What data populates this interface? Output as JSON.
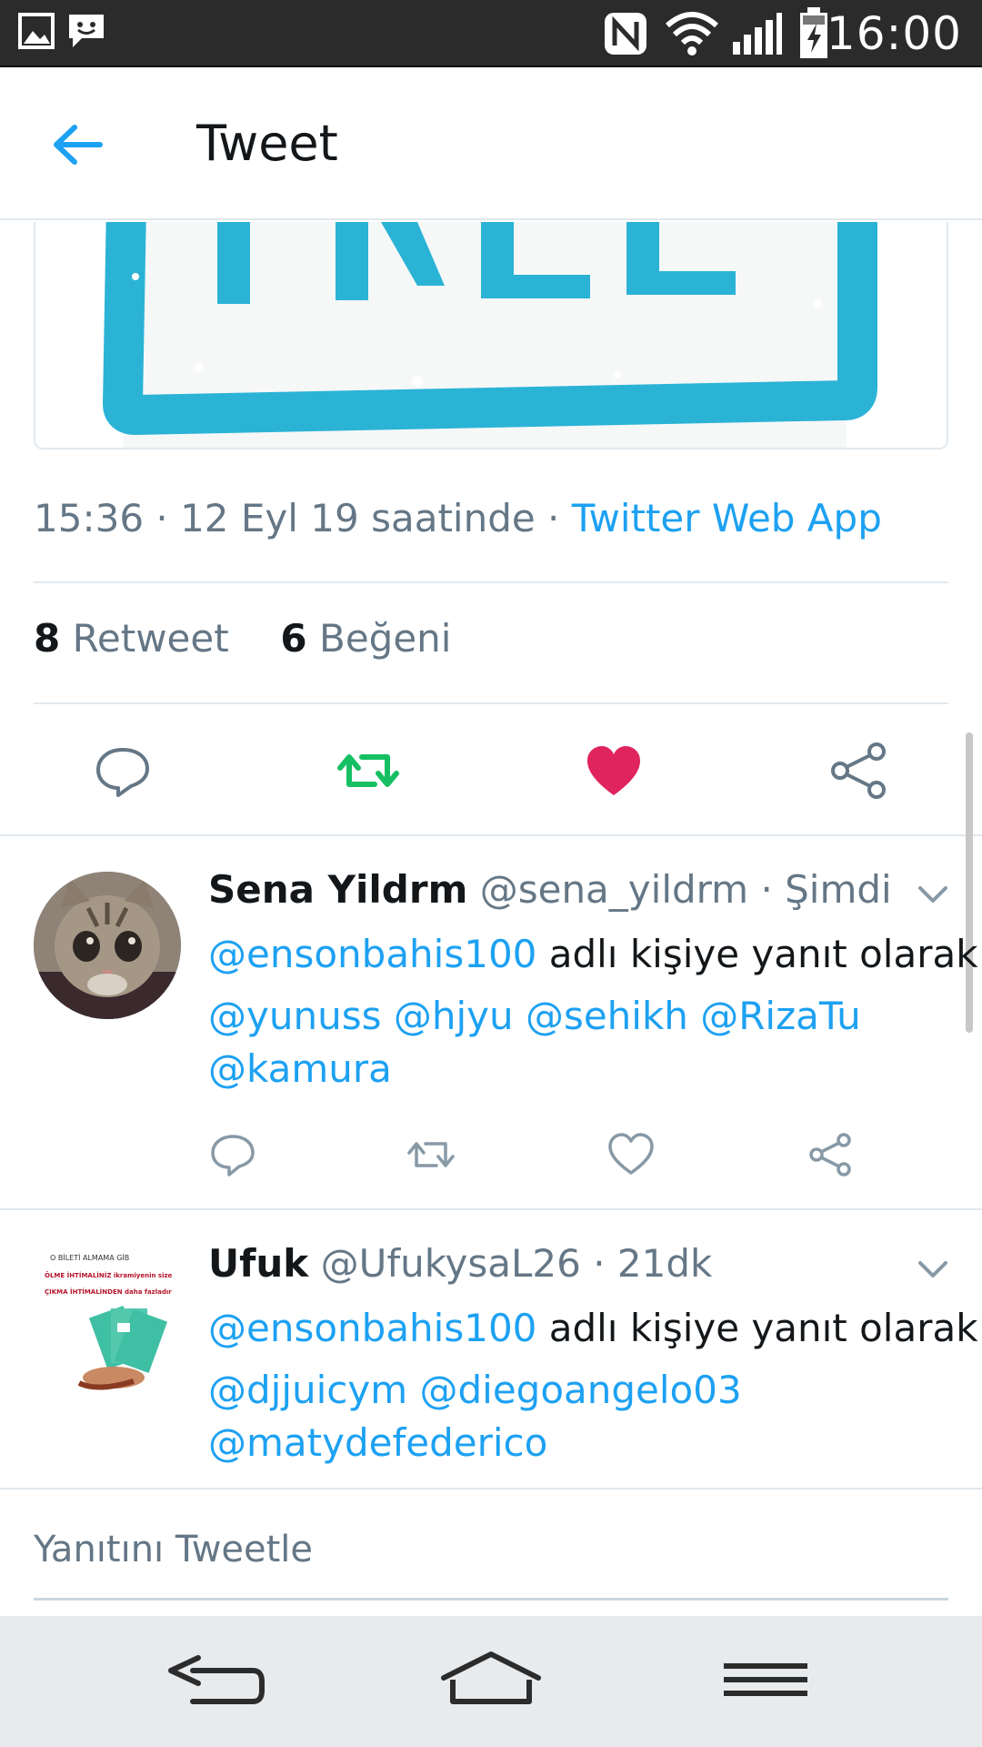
{
  "status_bar": {
    "time": "16:00",
    "icons": [
      "gallery-icon",
      "chat-icon",
      "nfc-icon",
      "wifi-icon",
      "signal-icon",
      "battery-charging-icon"
    ]
  },
  "header": {
    "title": "Tweet",
    "back_icon": "arrow-left-icon"
  },
  "media": {
    "stamp_text": "FREE",
    "accent_color": "#2bb3d6"
  },
  "tweet": {
    "timestamp": "15:36 · 12 Eyl 19 saatinde · ",
    "source": "Twitter Web App",
    "retweet_count": "8",
    "retweet_label": "Retweet",
    "like_count": "6",
    "like_label": "Beğeni",
    "liked": true,
    "retweeted": true
  },
  "replies": [
    {
      "name": "Sena Yildrm",
      "handle": "@sena_yildrm · Şimdi",
      "reply_to_mention": "@ensonbahis100",
      "reply_to_suffix": " adlı kişiye yanıt olarak",
      "line2": "@yunuss @hjyu @sehikh @RizaTu",
      "line3": "@kamura"
    },
    {
      "name": "Ufuk",
      "handle": "@UfukysaL26 · 21dk",
      "reply_to_mention": "@ensonbahis100",
      "reply_to_suffix": " adlı kişiye yanıt olarak",
      "line2": "@djjuicym @diegoangelo03",
      "line3": "@matydefederico",
      "avatar_text_1": "O BİLETİ ALMAMA GİB",
      "avatar_text_2": "ÖLME İHTİMALİNİZ ikramiyenin size",
      "avatar_text_3": "ÇIKMA İHTİMALİNDEN daha fazladır"
    }
  ],
  "compose": {
    "placeholder": "Yanıtını Tweetle"
  },
  "colors": {
    "brand": "#1da1f2",
    "retweet": "#17bf63",
    "like": "#e0245e",
    "text_secondary": "#657786"
  }
}
